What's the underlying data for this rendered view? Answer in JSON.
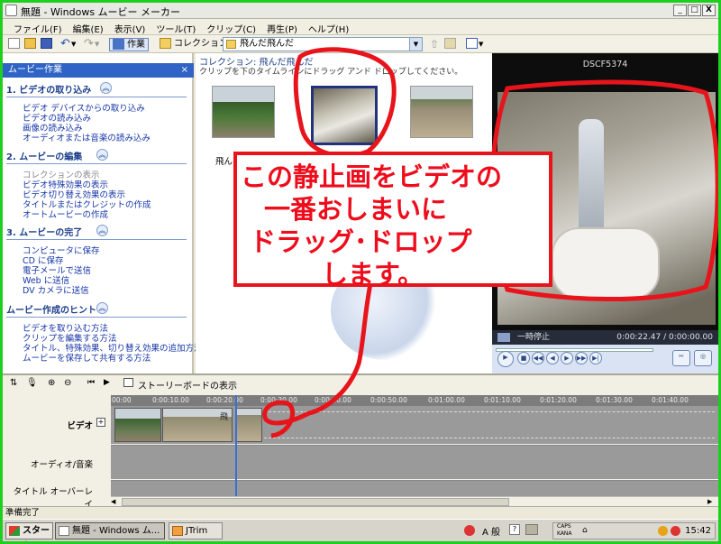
{
  "window": {
    "title": "無題 - Windows ムービー メーカー",
    "min": "_",
    "max": "□",
    "close": "X"
  },
  "menu": [
    "ファイル(F)",
    "編集(E)",
    "表示(V)",
    "ツール(T)",
    "クリップ(C)",
    "再生(P)",
    "ヘルプ(H)"
  ],
  "toolbar": {
    "tasks_label": "作業",
    "collections_label": "コレクション",
    "collection_value": "飛んだ飛んだ"
  },
  "taskpane": {
    "header": "ムービー作業",
    "sections": [
      {
        "title": "1. ビデオの取り込み",
        "items": [
          "ビデオ デバイスからの取り込み",
          "ビデオの読み込み",
          "画像の読み込み",
          "オーディオまたは音楽の読み込み"
        ]
      },
      {
        "title": "2. ムービーの編集",
        "items": [
          "コレクションの表示",
          "ビデオ特殊効果の表示",
          "ビデオ切り替え効果の表示",
          "タイトルまたはクレジットの作成",
          "オートムービーの作成"
        ]
      },
      {
        "title": "3. ムービーの完了",
        "items": [
          "コンピュータに保存",
          "CD に保存",
          "電子メールで送信",
          "Web に送信",
          "DV カメラに送信"
        ]
      },
      {
        "title": "ムービー作成のヒント",
        "items": [
          "ビデオを取り込む方法",
          "クリップを編集する方法",
          "タイトル、特殊効果、切り替え効果の追加方法",
          "ムービーを保存して共有する方法"
        ]
      }
    ]
  },
  "collection": {
    "title": "コレクション: 飛んだ飛んだ",
    "hint": "クリップを下のタイムラインにドラッグ アンド ドロップしてください。",
    "clips": [
      {
        "label": "飛ん"
      },
      {
        "label": ""
      },
      {
        "label": ""
      }
    ]
  },
  "monitor": {
    "title": "DSCF5374",
    "status": "一時停止",
    "time": "0:00:22.47 / 0:00:00.00"
  },
  "timeline": {
    "storyboard_label": "ストーリーボードの表示",
    "ruler": [
      "00:00",
      "0:00:10.00",
      "0:00:20.00",
      "0:00:30.00",
      "0:00:40.00",
      "0:00:50.00",
      "0:01:00.00",
      "0:01:10.00",
      "0:01:20.00",
      "0:01:30.00",
      "0:01:40.00",
      "0:01:50.00"
    ],
    "tracks": {
      "video": "ビデオ",
      "audio": "オーディオ/音楽",
      "title_overlay": "タイトル オーバーレイ"
    },
    "clip_label": "飛"
  },
  "annotation": {
    "lines": [
      "この静止画をビデオの",
      "一番おしまいに",
      "ドラッグ･ドロップ",
      "します。"
    ]
  },
  "status": "準備完了",
  "taskbar": {
    "start": "スタート",
    "tasks": [
      "無題 - Windows ム...",
      "JTrim"
    ],
    "ime": "A 般",
    "caps": "CAPS",
    "kana": "KANA",
    "clock": "15:42"
  }
}
